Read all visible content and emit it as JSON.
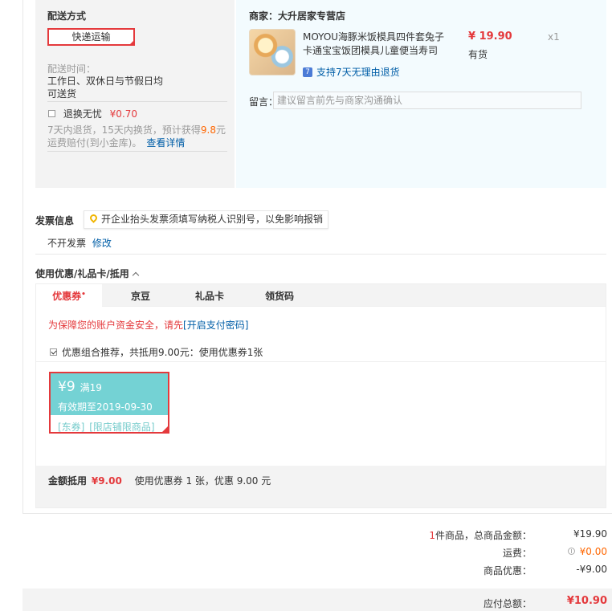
{
  "shipping": {
    "title": "配送方式",
    "method": "快递运输",
    "time_label": "配送时间：",
    "time_line1": "工作日、双休日与节假日均",
    "time_line2": "可送货",
    "insurance_label": "退换无忧",
    "insurance_price": "¥0.70",
    "insurance_desc_prefix": "7天内退货，15天内换货，预计获得",
    "insurance_points": "9.8",
    "insurance_desc_suffix": "元",
    "insurance_desc2": "运费赔付(到小金库)。",
    "insurance_link": "查看详情"
  },
  "shop": {
    "title": "商家：大升居家专营店",
    "product_line1": "MOYOU海豚米饭模具四件套兔子",
    "product_line2": "卡通宝宝饭团模具儿童便当寿司",
    "price": "¥ 19.90",
    "stock": "有货",
    "qty": "x1",
    "return_icon": "7",
    "return_policy": "支持7天无理由退货",
    "remark_label": "留言：",
    "remark_placeholder": "建议留言前先与商家沟通确认"
  },
  "invoice": {
    "title": "发票信息",
    "tip": "开企业抬头发票须填写纳税人识别号，以免影响报销",
    "status": "不开发票",
    "edit": "修改"
  },
  "discount": {
    "title": "使用优惠/礼品卡/抵用",
    "tabs": [
      "优惠券",
      "京豆",
      "礼品卡",
      "领货码"
    ],
    "tab_marker": "•",
    "security_prefix": "为保障您的账户资金安全，请先",
    "security_link": "[开启支付密码]",
    "recommend": "优惠组合推荐，共抵用9.00元：使用优惠券1张",
    "coupon": {
      "amount": "¥9",
      "condition": "满19",
      "valid": "有效期至2019-09-30",
      "tag1": "[东券]",
      "tag2": "[限店铺限商品]"
    },
    "summary_label": "金额抵用",
    "summary_amount": "¥9.00",
    "summary_desc": "使用优惠券 1 张，优惠 9.00 元"
  },
  "totals": {
    "count": "1",
    "count_suffix": "件商品，总商品金额：",
    "goods_amount": "¥19.90",
    "freight_label": "运费：",
    "freight_amount": "¥0.00",
    "promo_label": "商品优惠：",
    "promo_amount": "-¥9.00",
    "payable_label": "应付总额：",
    "payable_amount": "¥10.90"
  },
  "colors": {
    "accent": "#e4393c",
    "link": "#005ea7",
    "coupon": "#74d2d4"
  }
}
